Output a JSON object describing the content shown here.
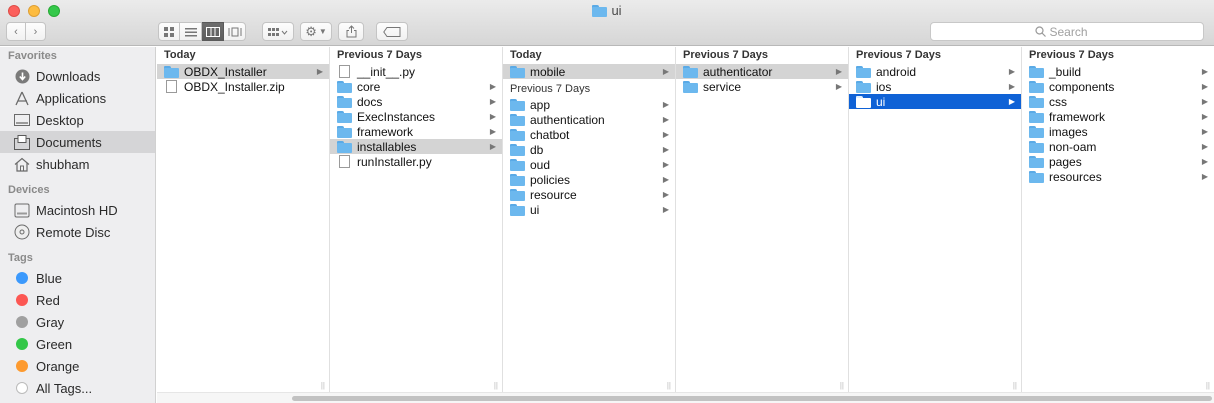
{
  "window": {
    "title": "ui"
  },
  "toolbar": {
    "back": "‹",
    "forward": "›",
    "views": [
      "icon-view",
      "list-view",
      "column-view",
      "gallery-view"
    ],
    "search_placeholder": "Search"
  },
  "sidebar": {
    "favorites_header": "Favorites",
    "favorites": [
      {
        "label": "Downloads",
        "icon": "download-icon"
      },
      {
        "label": "Applications",
        "icon": "applications-icon"
      },
      {
        "label": "Desktop",
        "icon": "desktop-icon"
      },
      {
        "label": "Documents",
        "icon": "documents-icon"
      },
      {
        "label": "shubham",
        "icon": "home-icon"
      }
    ],
    "devices_header": "Devices",
    "devices": [
      {
        "label": "Macintosh HD",
        "icon": "disk-icon"
      },
      {
        "label": "Remote Disc",
        "icon": "disc-icon"
      }
    ],
    "tags_header": "Tags",
    "tags": [
      {
        "label": "Blue",
        "color": "#3b99fc"
      },
      {
        "label": "Red",
        "color": "#fc5753"
      },
      {
        "label": "Gray",
        "color": "#a0a0a0"
      },
      {
        "label": "Green",
        "color": "#33c748"
      },
      {
        "label": "Orange",
        "color": "#fd9a2f"
      },
      {
        "label": "All Tags...",
        "color": "#d0d0d0"
      }
    ]
  },
  "columns": [
    {
      "header": "Today",
      "items": [
        {
          "name": "OBDX_Installer",
          "type": "folder",
          "state": "gray",
          "chevron": true
        },
        {
          "name": "OBDX_Installer.zip",
          "type": "file"
        }
      ]
    },
    {
      "header": "Previous 7 Days",
      "items": [
        {
          "name": "__init__.py",
          "type": "file"
        },
        {
          "name": "core",
          "type": "folder",
          "chevron": true
        },
        {
          "name": "docs",
          "type": "folder",
          "chevron": true
        },
        {
          "name": "ExecInstances",
          "type": "folder",
          "chevron": true
        },
        {
          "name": "framework",
          "type": "folder",
          "chevron": true
        },
        {
          "name": "installables",
          "type": "folder",
          "state": "gray",
          "chevron": true
        },
        {
          "name": "runInstaller.py",
          "type": "file"
        }
      ]
    },
    {
      "header": "Today",
      "items": [
        {
          "name": "mobile",
          "type": "folder",
          "state": "gray",
          "chevron": true
        }
      ],
      "subheader": "Previous 7 Days",
      "items2": [
        {
          "name": "app",
          "type": "folder",
          "chevron": true
        },
        {
          "name": "authentication",
          "type": "folder",
          "chevron": true
        },
        {
          "name": "chatbot",
          "type": "folder",
          "chevron": true
        },
        {
          "name": "db",
          "type": "folder",
          "chevron": true
        },
        {
          "name": "oud",
          "type": "folder",
          "chevron": true
        },
        {
          "name": "policies",
          "type": "folder",
          "chevron": true
        },
        {
          "name": "resource",
          "type": "folder",
          "chevron": true
        },
        {
          "name": "ui",
          "type": "folder",
          "chevron": true
        }
      ]
    },
    {
      "header": "Previous 7 Days",
      "items": [
        {
          "name": "authenticator",
          "type": "folder",
          "state": "gray",
          "chevron": true
        },
        {
          "name": "service",
          "type": "folder",
          "chevron": true
        }
      ]
    },
    {
      "header": "Previous 7 Days",
      "items": [
        {
          "name": "android",
          "type": "folder",
          "chevron": true
        },
        {
          "name": "ios",
          "type": "folder",
          "chevron": true
        },
        {
          "name": "ui",
          "type": "folder",
          "state": "blue",
          "chevron": true
        }
      ]
    },
    {
      "header": "Previous 7 Days",
      "items": [
        {
          "name": "_build",
          "type": "folder",
          "chevron": true
        },
        {
          "name": "components",
          "type": "folder",
          "chevron": true
        },
        {
          "name": "css",
          "type": "folder",
          "chevron": true
        },
        {
          "name": "framework",
          "type": "folder",
          "chevron": true
        },
        {
          "name": "images",
          "type": "folder",
          "chevron": true
        },
        {
          "name": "non-oam",
          "type": "folder",
          "chevron": true
        },
        {
          "name": "pages",
          "type": "folder",
          "chevron": true
        },
        {
          "name": "resources",
          "type": "folder",
          "chevron": true
        }
      ]
    }
  ]
}
